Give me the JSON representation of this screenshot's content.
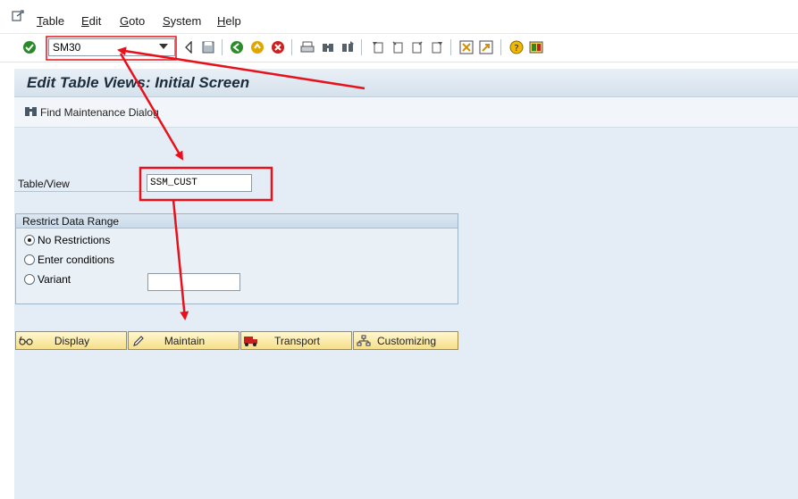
{
  "menu": {
    "items": [
      {
        "label": "Table",
        "mnemonic": "T",
        "rest": "able"
      },
      {
        "label": "Edit",
        "mnemonic": "E",
        "rest": "dit"
      },
      {
        "label": "Goto",
        "mnemonic": "G",
        "rest": "oto"
      },
      {
        "label": "System",
        "mnemonic": "S",
        "rest": "ystem"
      },
      {
        "label": "Help",
        "mnemonic": "H",
        "rest": "elp"
      }
    ]
  },
  "toolbar": {
    "command_value": "SM30"
  },
  "title": "Edit Table Views: Initial Screen",
  "app_toolbar": {
    "find_label": "Find Maintenance Dialog"
  },
  "form": {
    "table_view_label": "Table/View",
    "table_view_value": "SSM_CUST"
  },
  "restrict": {
    "title": "Restrict Data Range",
    "options": [
      {
        "label": "No Restrictions",
        "selected": true
      },
      {
        "label": "Enter conditions",
        "selected": false
      },
      {
        "label": "Variant",
        "selected": false
      }
    ],
    "variant_value": ""
  },
  "buttons": {
    "display": "Display",
    "maintain": "Maintain",
    "transport": "Transport",
    "customizing": "Customizing"
  },
  "colors": {
    "annotation": "#e8101a",
    "title_bg": "#dbe6f0",
    "button_bg": "#f6df8b"
  }
}
